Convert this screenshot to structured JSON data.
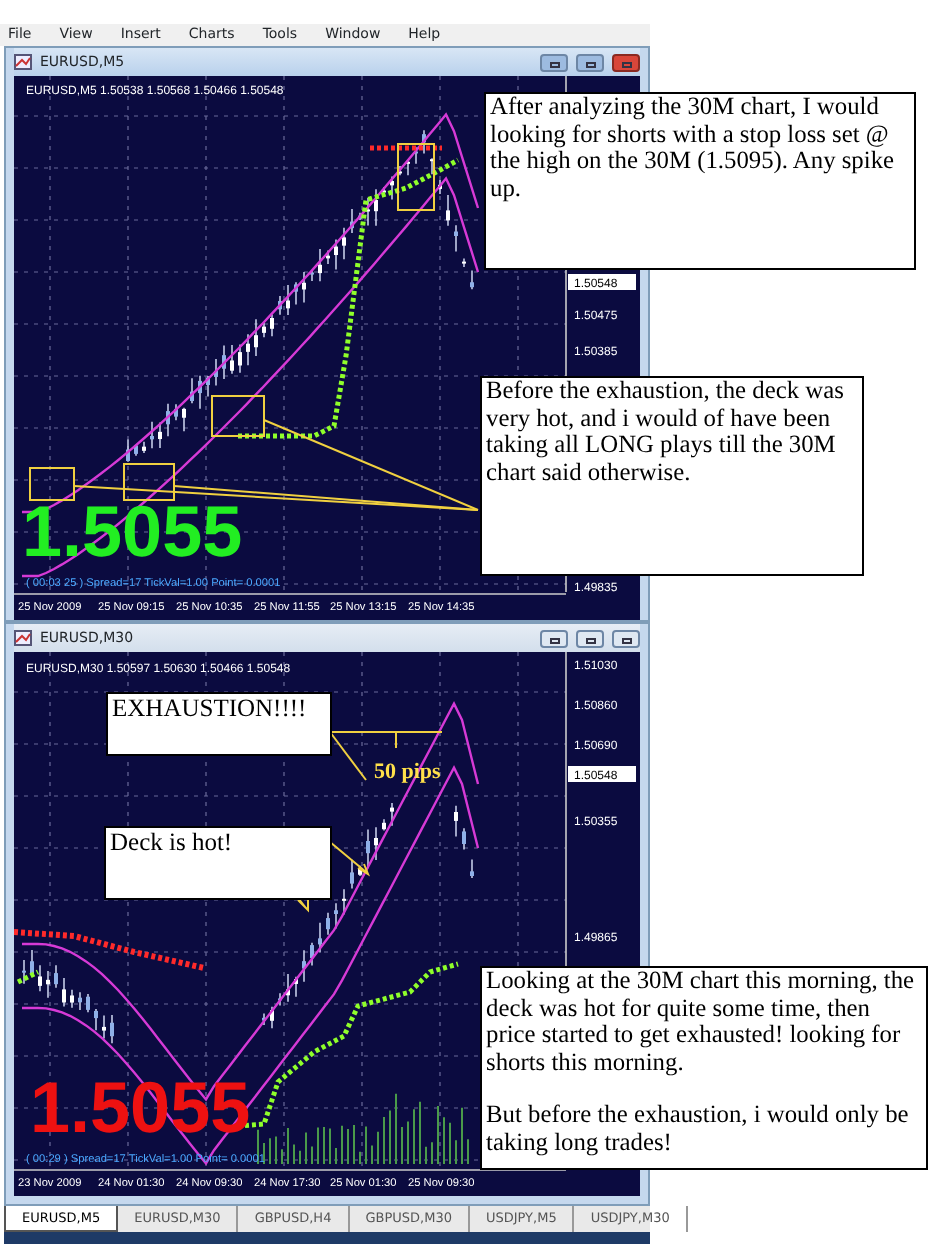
{
  "menu": [
    "File",
    "View",
    "Insert",
    "Charts",
    "Tools",
    "Window",
    "Help"
  ],
  "windows": [
    {
      "title": "EURUSD,M5",
      "active": true,
      "info": "EURUSD,M5  1.50538 1.50568 1.50466 1.50548",
      "price_labels": [
        {
          "text": "1.50548",
          "current": true
        },
        {
          "text": "1.50475",
          "current": false
        },
        {
          "text": "1.50385",
          "current": false
        },
        {
          "text": "1.49835",
          "current": false
        }
      ],
      "time_labels": [
        "25 Nov 2009",
        "25 Nov 09:15",
        "25 Nov 10:35",
        "25 Nov 11:55",
        "25 Nov 13:15",
        "25 Nov 14:35"
      ],
      "status_line": "( 00:03 25 )  Spread=17  TickVal=1.00  Point= 0.0001",
      "big_price": {
        "text": "1.5055",
        "color": "#22ee22"
      }
    },
    {
      "title": "EURUSD,M30",
      "active": false,
      "info": "EURUSD,M30  1.50597 1.50630 1.50466 1.50548",
      "price_labels": [
        {
          "text": "1.51030",
          "current": false
        },
        {
          "text": "1.50860",
          "current": false
        },
        {
          "text": "1.50690",
          "current": false
        },
        {
          "text": "1.50548",
          "current": true
        },
        {
          "text": "1.50355",
          "current": false
        },
        {
          "text": "1.49865",
          "current": false
        }
      ],
      "time_labels": [
        "23 Nov 2009",
        "24 Nov 01:30",
        "24 Nov 09:30",
        "24 Nov 17:30",
        "25 Nov 01:30",
        "25 Nov 09:30"
      ],
      "status_line": "( 00:29 )  Spread=17  TickVal=1.00  Point= 0.0001",
      "big_price": {
        "text": "1.5055",
        "color": "#ee1111"
      },
      "labels": [
        {
          "kind": "box",
          "text": "EXHAUSTION!!!!"
        },
        {
          "kind": "pips",
          "text": "50 pips"
        },
        {
          "kind": "box",
          "text": "Deck is hot!"
        }
      ]
    }
  ],
  "tabs": [
    {
      "label": "EURUSD,M5",
      "selected": true
    },
    {
      "label": "EURUSD,M30",
      "selected": false
    },
    {
      "label": "GBPUSD,H4",
      "selected": false
    },
    {
      "label": "GBPUSD,M30",
      "selected": false
    },
    {
      "label": "USDJPY,M5",
      "selected": false
    },
    {
      "label": "USDJPY,M30",
      "selected": false
    }
  ],
  "notes": [
    {
      "paragraphs": [
        "After analyzing the 30M chart, I would looking for shorts with a stop loss set @ the high on the 30M (1.5095).  Any spike up."
      ]
    },
    {
      "paragraphs": [
        "Before the exhaustion, the deck was very hot, and i would of have been taking all LONG plays till the 30M chart said otherwise."
      ]
    },
    {
      "paragraphs": [
        "Looking at the 30M chart this morning, the deck was hot for quite some time, then price started to get exhausted!  looking for shorts this morning.",
        "But before the exhaustion, i would only be taking long trades!"
      ]
    }
  ]
}
